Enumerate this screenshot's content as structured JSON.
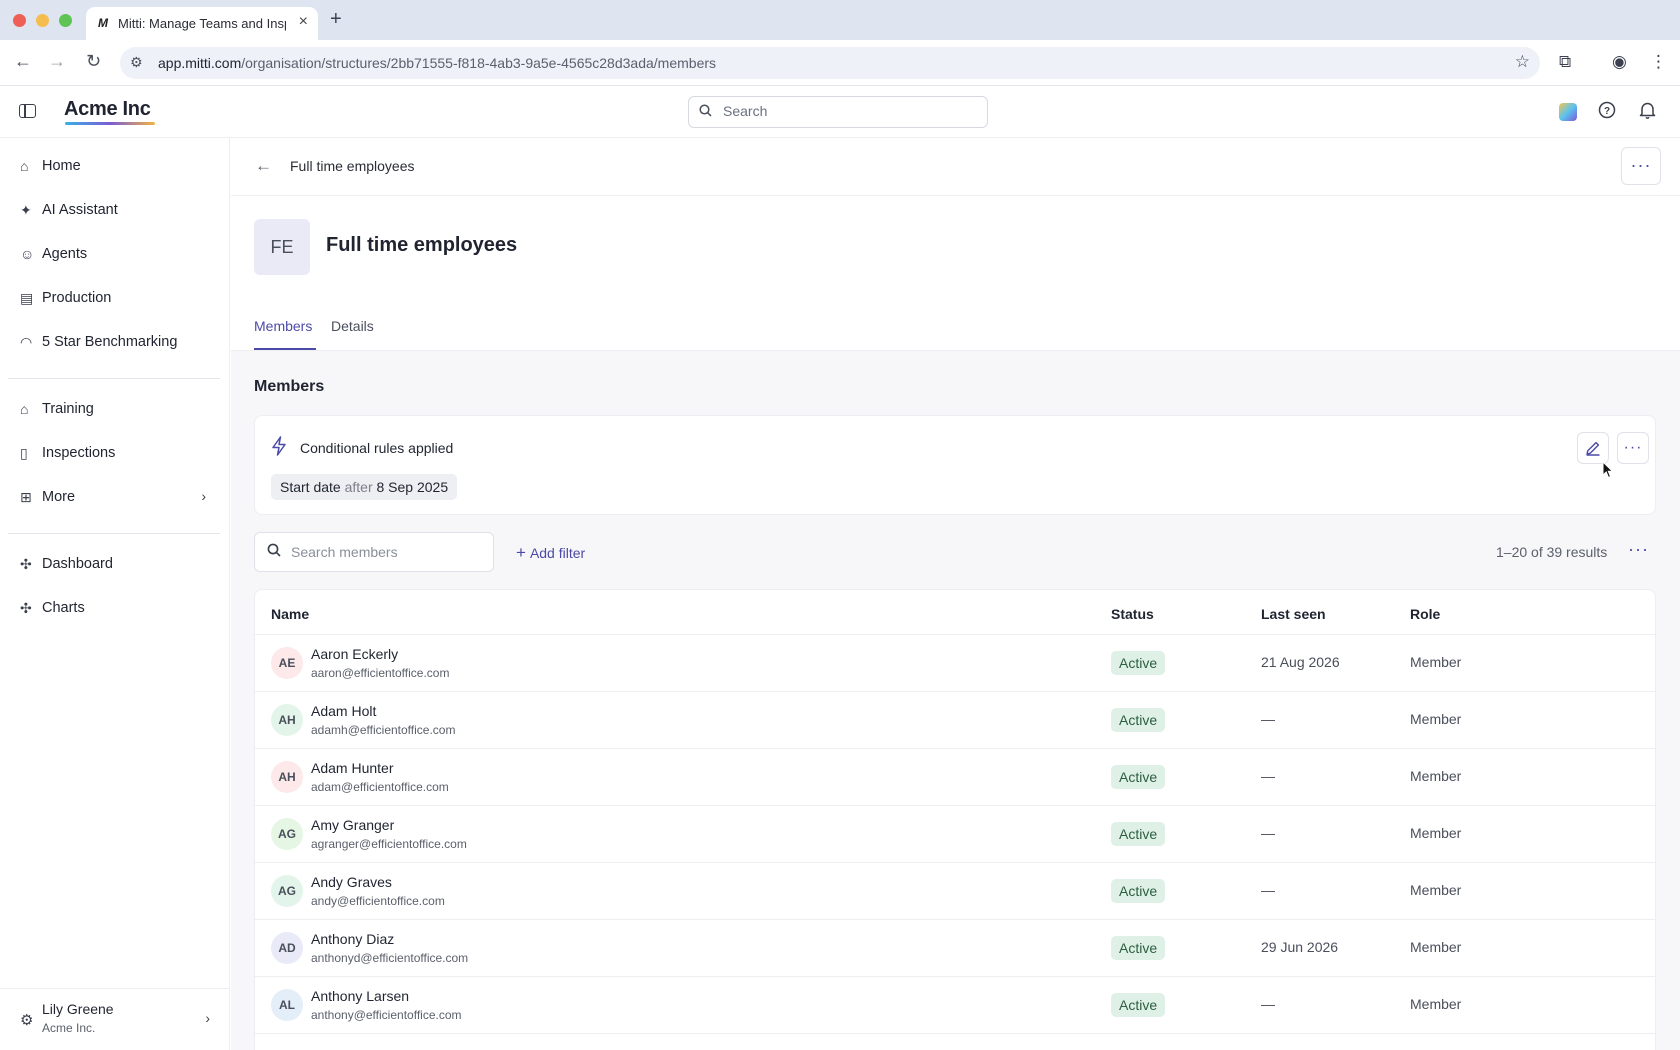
{
  "browser": {
    "tab_title": "Mitti: Manage Teams and Inspections",
    "tab_favicon": "M",
    "url_host": "app.mitti.com",
    "url_path": "/organisation/structures/2bb71555-f818-4ab3-9a5e-4565c28d3ada/members"
  },
  "header": {
    "brand": "Acme Inc",
    "search_placeholder": "Search"
  },
  "sidebar": {
    "items": [
      {
        "label": "Home",
        "icon": "home-icon"
      },
      {
        "label": "AI Assistant",
        "icon": "sparkle-icon"
      },
      {
        "label": "Agents",
        "icon": "robot-icon"
      },
      {
        "label": "Production",
        "icon": "building-icon"
      },
      {
        "label": "5 Star Benchmarking",
        "icon": "gauge-icon"
      },
      {
        "label": "Training",
        "icon": "graduation-cap-icon"
      },
      {
        "label": "Inspections",
        "icon": "clipboard-icon"
      },
      {
        "label": "More",
        "icon": "grid-icon"
      },
      {
        "label": "Dashboard",
        "icon": "puzzle-icon"
      },
      {
        "label": "Charts",
        "icon": "puzzle-icon"
      }
    ],
    "user": {
      "name": "Lily Greene",
      "org": "Acme Inc."
    }
  },
  "page": {
    "breadcrumb": "Full time employees",
    "avatar_initials": "FE",
    "title": "Full time employees",
    "tabs": [
      {
        "label": "Members",
        "active": true
      },
      {
        "label": "Details",
        "active": false
      }
    ],
    "section_heading": "Members",
    "rules": {
      "title": "Conditional rules applied",
      "chip_field": "Start date",
      "chip_operator": "after",
      "chip_value": "8 Sep 2025"
    },
    "member_search_placeholder": "Search members",
    "add_filter_label": "Add filter",
    "results_count": "1–20 of 39 results"
  },
  "table": {
    "columns": [
      "Name",
      "Status",
      "Last seen",
      "Role"
    ],
    "rows": [
      {
        "initials": "AE",
        "name": "Aaron Eckerly",
        "email": "aaron@efficientoffice.com",
        "status": "Active",
        "last_seen": "21 Aug 2026",
        "role": "Member",
        "avatar_color": "#fde8ea"
      },
      {
        "initials": "AH",
        "name": "Adam Holt",
        "email": "adamh@efficientoffice.com",
        "status": "Active",
        "last_seen": "—",
        "role": "Member",
        "avatar_color": "#e3f5ea"
      },
      {
        "initials": "AH",
        "name": "Adam Hunter",
        "email": "adam@efficientoffice.com",
        "status": "Active",
        "last_seen": "—",
        "role": "Member",
        "avatar_color": "#fde8ea"
      },
      {
        "initials": "AG",
        "name": "Amy Granger",
        "email": "agranger@efficientoffice.com",
        "status": "Active",
        "last_seen": "—",
        "role": "Member",
        "avatar_color": "#e6f6e4"
      },
      {
        "initials": "AG",
        "name": "Andy Graves",
        "email": "andy@efficientoffice.com",
        "status": "Active",
        "last_seen": "—",
        "role": "Member",
        "avatar_color": "#e3f5ea"
      },
      {
        "initials": "AD",
        "name": "Anthony Diaz",
        "email": "anthonyd@efficientoffice.com",
        "status": "Active",
        "last_seen": "29 Jun 2026",
        "role": "Member",
        "avatar_color": "#e8eaf7"
      },
      {
        "initials": "AL",
        "name": "Anthony Larsen",
        "email": "anthony@efficientoffice.com",
        "status": "Active",
        "last_seen": "—",
        "role": "Member",
        "avatar_color": "#e4eef9"
      }
    ]
  },
  "colors": {
    "accent": "#4c4aa8",
    "status_active_bg": "#dff1e7"
  }
}
